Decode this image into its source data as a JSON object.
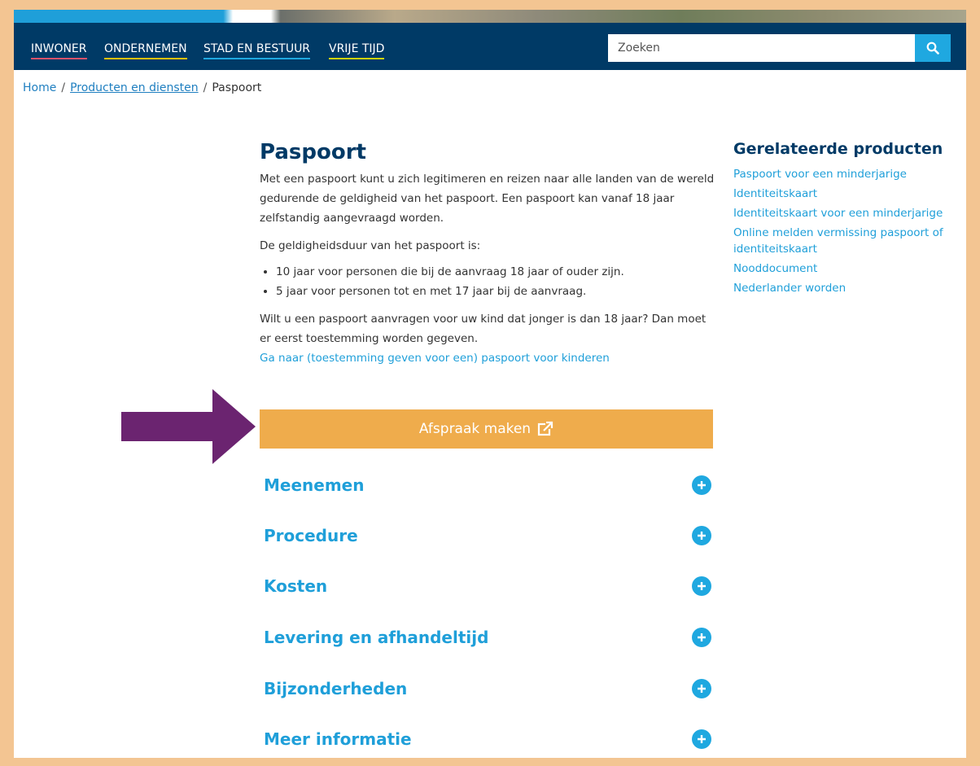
{
  "nav": {
    "items": [
      "INWONER",
      "ONDERNEMEN",
      "STAD EN BESTUUR",
      "VRIJE TIJD"
    ],
    "search_placeholder": "Zoeken"
  },
  "breadcrumb": [
    "Home",
    "Producten en diensten",
    "Paspoort"
  ],
  "main": {
    "title": "Paspoort",
    "intro": "Met een paspoort kunt u zich legitimeren en reizen naar alle landen van de wereld gedurende de geldigheid van het paspoort. Een paspoort kan vanaf 18 jaar zelfstandig aangevraagd worden.",
    "validity_intro": "De geldigheidsduur van het paspoort is:",
    "validity_items": [
      "10 jaar voor personen die bij de aanvraag 18 jaar of ouder zijn.",
      "5 jaar voor personen tot en met 17 jaar bij de aanvraag."
    ],
    "child_text": "Wilt u een paspoort aanvragen voor uw kind dat jonger is dan 18 jaar? Dan moet er eerst toestemming worden gegeven.",
    "child_link": "Ga naar (toestemming geven voor een) paspoort voor kinderen",
    "appointment_button": "Afspraak maken",
    "accordion": [
      "Meenemen",
      "Procedure",
      "Kosten",
      "Levering en afhandeltijd",
      "Bijzonderheden",
      "Meer informatie"
    ]
  },
  "sidebar": {
    "title": "Gerelateerde producten",
    "links": [
      "Paspoort voor een minderjarige",
      "Identiteitskaart",
      "Identiteitskaart voor een minderjarige",
      "Online melden vermissing paspoort of identiteitskaart",
      "Nooddocument",
      "Nederlander worden"
    ]
  },
  "colors": {
    "navy": "#003a66",
    "accent_blue": "#1fa8e0",
    "button_orange": "#efac4c",
    "arrow_purple": "#6b2470",
    "frame_border": "#f3c592"
  }
}
